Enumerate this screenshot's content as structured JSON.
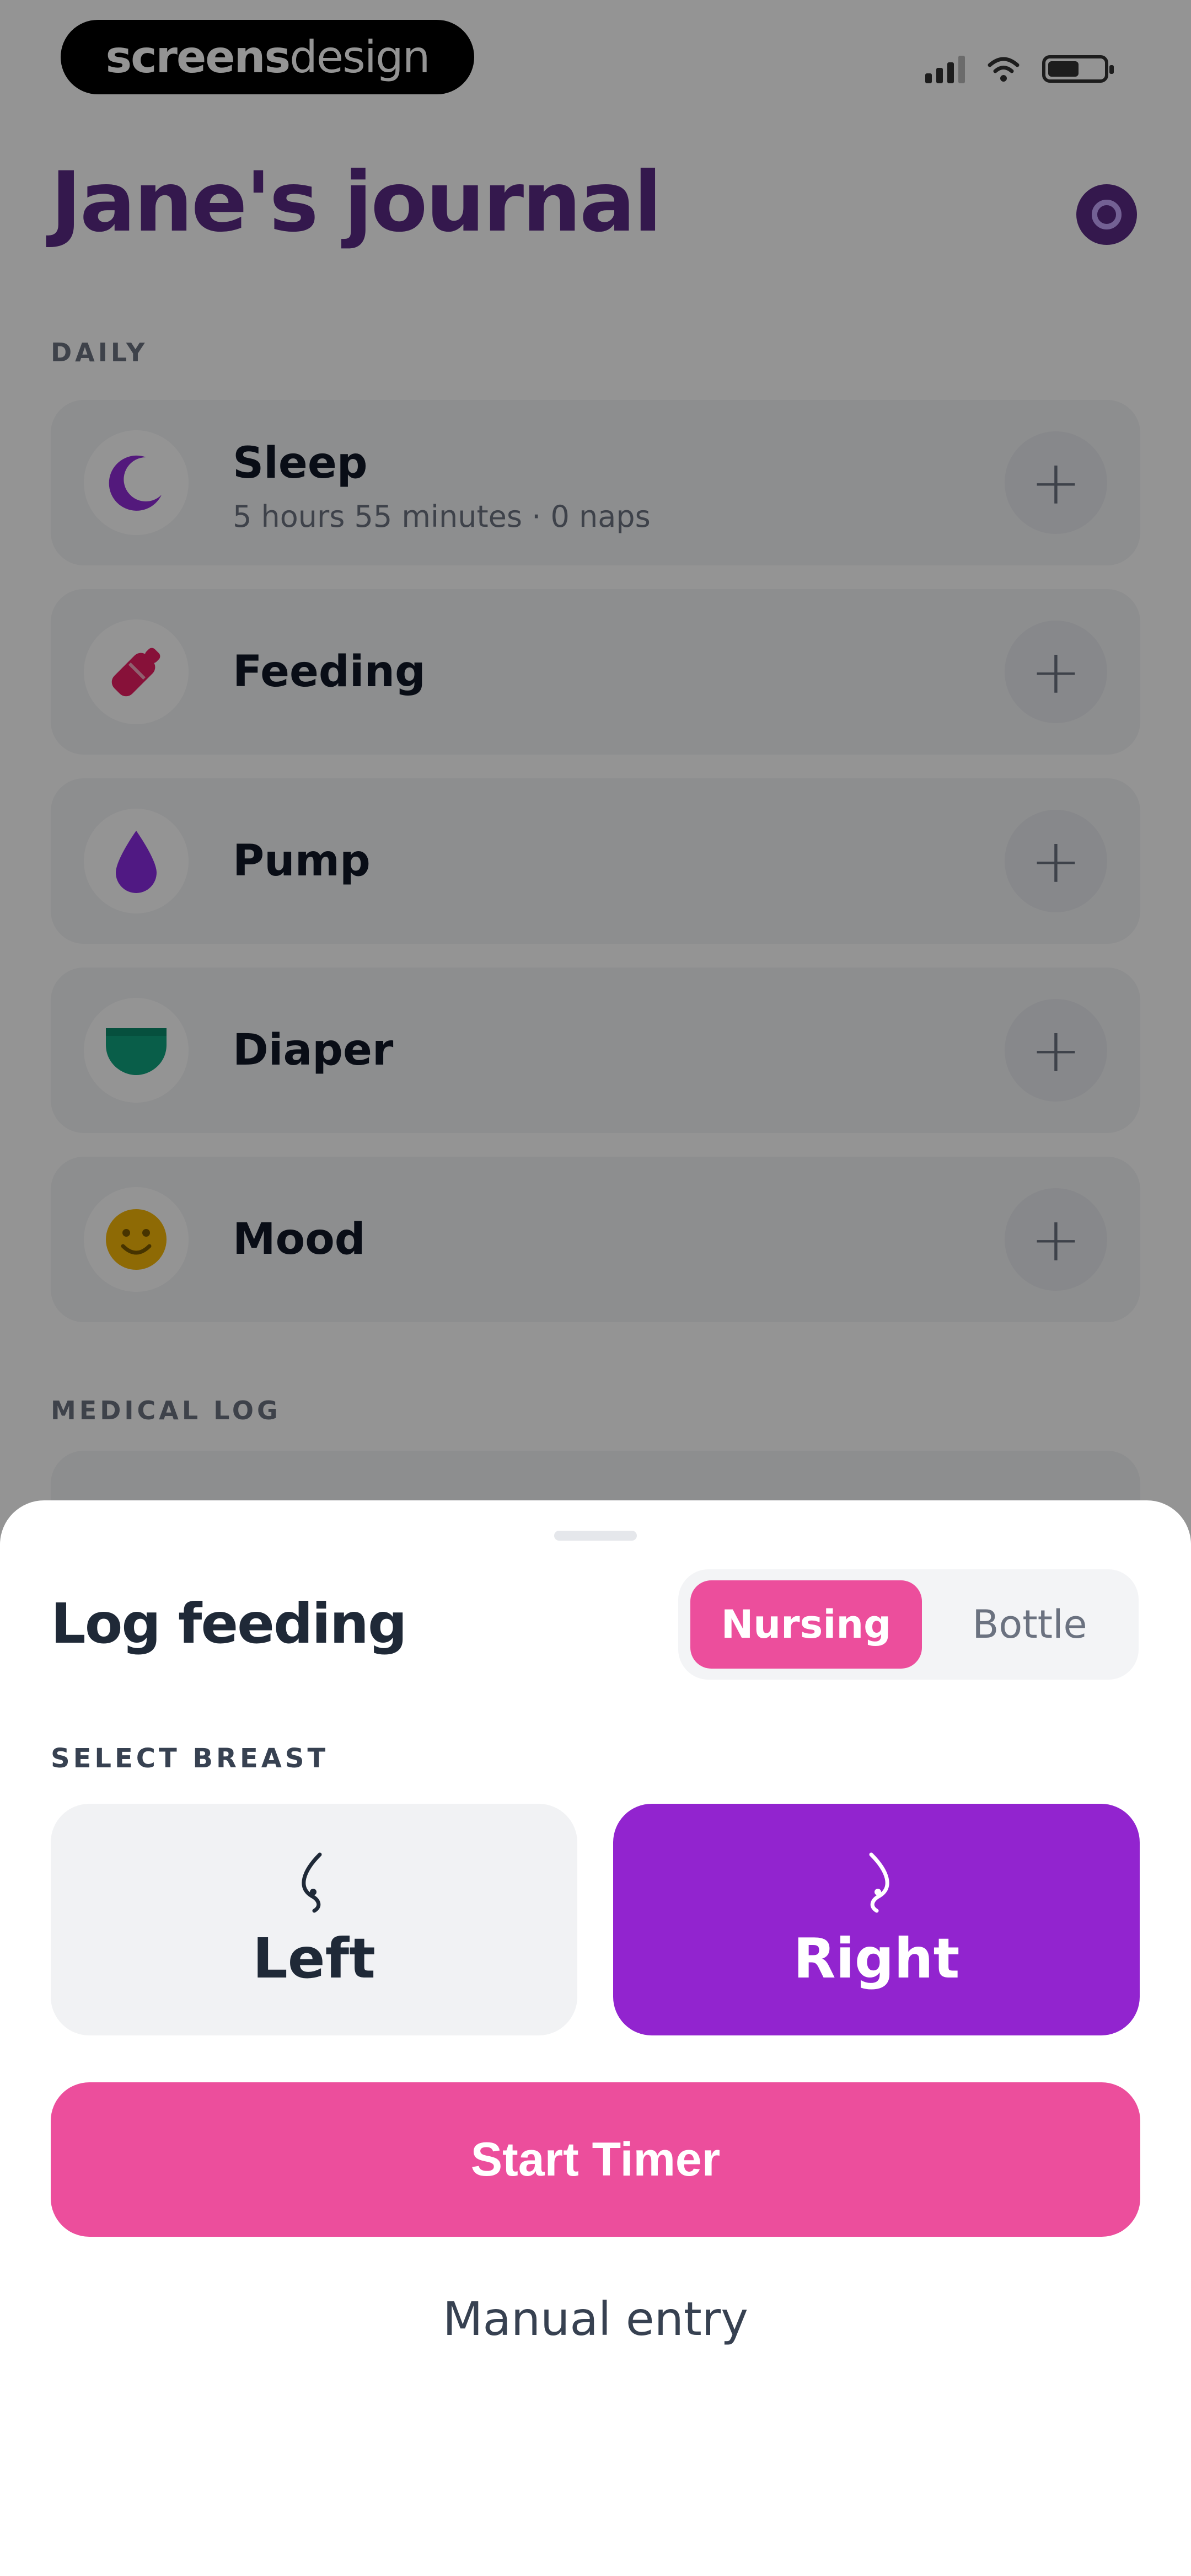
{
  "status_bar": {
    "brand_strong": "screens",
    "brand_light": "design"
  },
  "header": {
    "title": "Jane's journal",
    "settings_icon": "settings-icon"
  },
  "daily": {
    "label": "DAILY",
    "items": [
      {
        "title": "Sleep",
        "subtitle": "5 hours 55 minutes · 0 naps",
        "icon": "moon-icon",
        "color": "#8f2bd6"
      },
      {
        "title": "Feeding",
        "icon": "bottle-icon",
        "color": "#e91e63"
      },
      {
        "title": "Pump",
        "icon": "drop-icon",
        "color": "#8a2be2"
      },
      {
        "title": "Diaper",
        "icon": "diaper-icon",
        "color": "#10a37f"
      },
      {
        "title": "Mood",
        "icon": "smiley-icon",
        "color": "#f5b70a"
      }
    ]
  },
  "medical": {
    "label": "MEDICAL LOG"
  },
  "sheet": {
    "title": "Log feeding",
    "segment": {
      "options": [
        "Nursing",
        "Bottle"
      ],
      "selected": "Nursing"
    },
    "select_label": "SELECT BREAST",
    "breast": {
      "left": "Left",
      "right": "Right",
      "selected": "Right"
    },
    "start_button": "Start Timer",
    "manual_entry": "Manual entry"
  },
  "colors": {
    "accent_pink": "#ec4e9c",
    "accent_purple": "#9224cf",
    "title_purple": "#5b2a86"
  }
}
